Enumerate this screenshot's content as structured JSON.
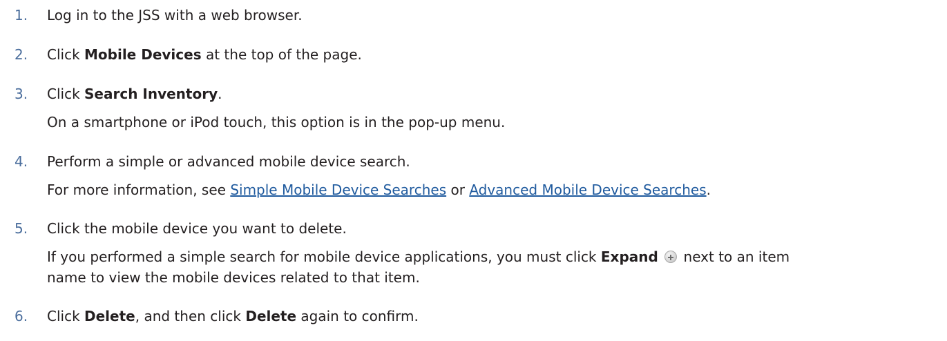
{
  "steps": [
    {
      "number": "1.",
      "text": "Log in to the JSS with a web browser."
    },
    {
      "number": "2.",
      "pre": "Click ",
      "bold": "Mobile Devices",
      "post": " at the top of the page."
    },
    {
      "number": "3.",
      "pre": "Click ",
      "bold": "Search Inventory",
      "post": ".",
      "note": "On a smartphone or iPod touch, this option is in the pop-up menu."
    },
    {
      "number": "4.",
      "text": "Perform a simple or advanced mobile device search.",
      "note_pre": "For more information, see ",
      "link1": "Simple Mobile Device Searches",
      "note_mid": " or ",
      "link2": "Advanced Mobile Device Searches",
      "note_post": "."
    },
    {
      "number": "5.",
      "text": "Click the mobile device you want to delete.",
      "note_pre": "If you performed a simple search for mobile device applications, you must click ",
      "note_bold": "Expand",
      "note_icon": "plus-circle-icon",
      "note_post": " next to an item",
      "note_line2": "name to view the mobile devices related to that item."
    },
    {
      "number": "6.",
      "pre": "Click ",
      "bold": "Delete",
      "mid": ", and then click ",
      "bold2": "Delete",
      "post": " again to confirm."
    }
  ],
  "colors": {
    "number": "#4a6d9c",
    "text": "#231f20",
    "link": "#1f5a9e"
  }
}
